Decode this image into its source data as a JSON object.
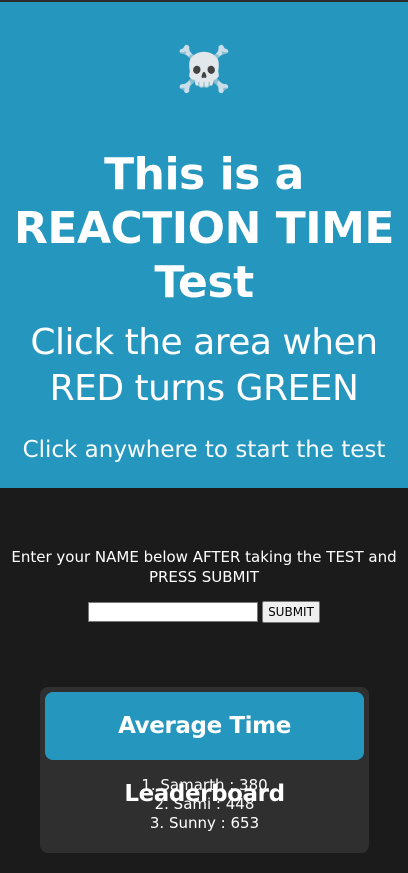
{
  "test_area": {
    "icon": "skull-and-crossbones-icon",
    "icon_glyph": "☠️",
    "title": "This is a REACTION TIME Test",
    "subtitle": "Click the area when RED turns GREEN",
    "start_hint": "Click anywhere to start the test",
    "background_color": "#2596be"
  },
  "name_form": {
    "instructions": "Enter your NAME below AFTER taking the TEST and PRESS SUBMIT",
    "input_value": "",
    "submit_label": "SUBMIT"
  },
  "leaderboard": {
    "title": "Average Time Leaderboard",
    "entries": [
      "1. Samarth : 380",
      "2. Sami : 448",
      "3. Sunny : 653"
    ]
  },
  "colors": {
    "accent": "#2596be",
    "page_background": "#1b1b1b",
    "card_background": "#2f2f2f"
  }
}
